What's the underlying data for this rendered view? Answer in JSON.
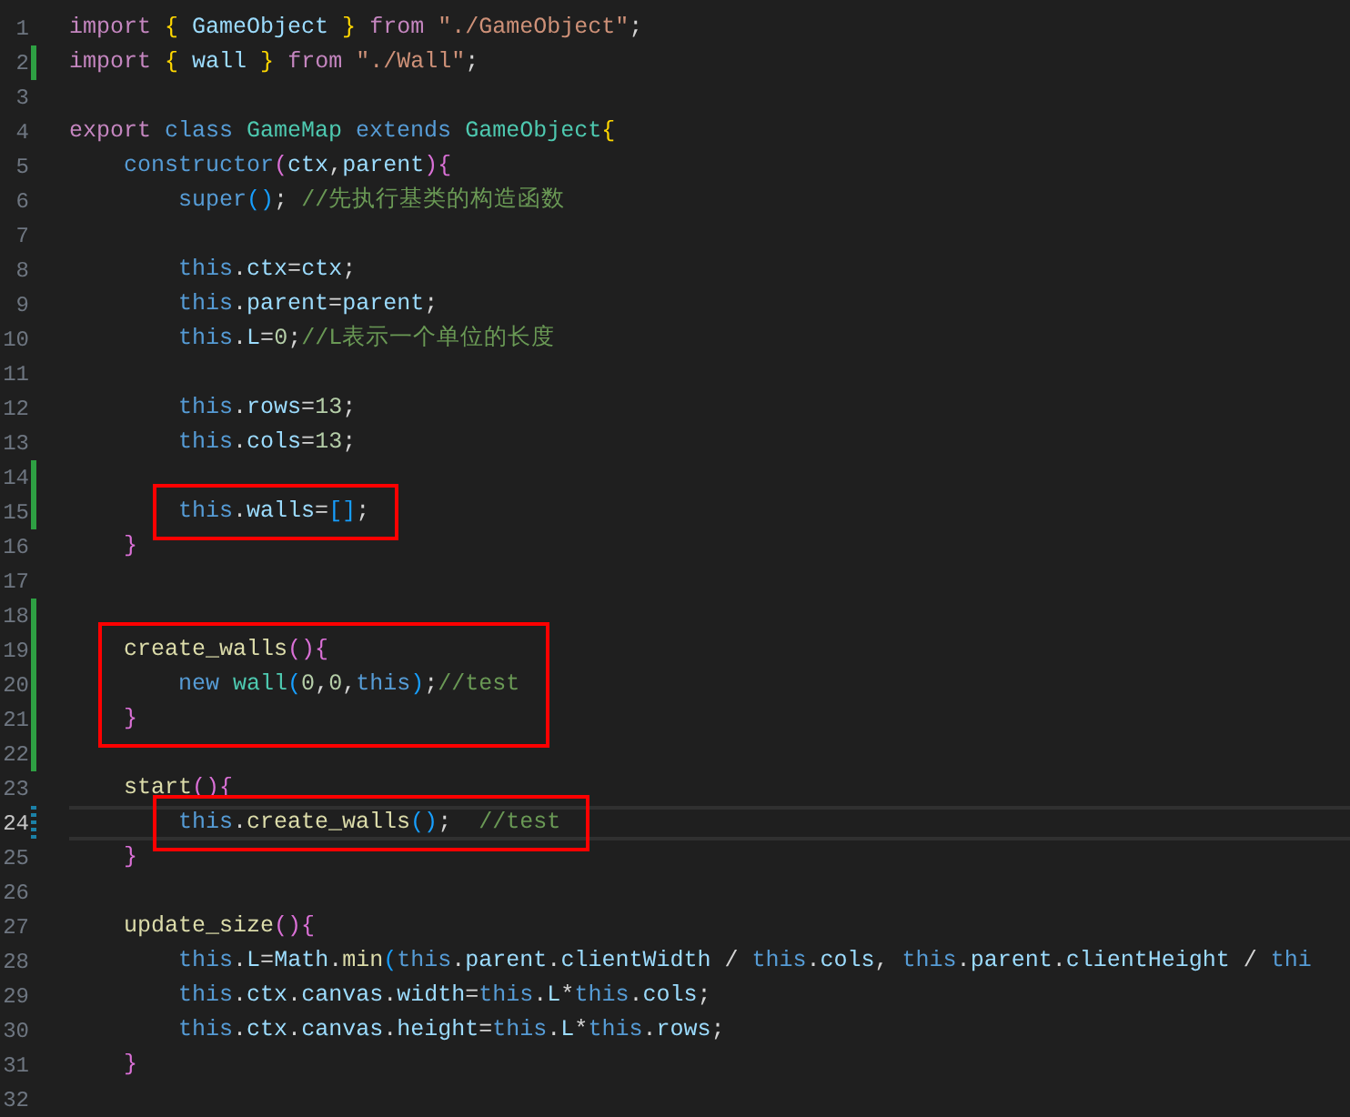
{
  "blocks": [
    {
      "boxed": false,
      "lines": [
        {
          "number": "1",
          "added": false,
          "modified": false,
          "current": false,
          "tokens": [
            {
              "text": "import ",
              "color": "#c586c0"
            },
            {
              "text": "{ ",
              "color": "#ffd700"
            },
            {
              "text": "GameObject ",
              "color": "#9cdcfe"
            },
            {
              "text": "} ",
              "color": "#ffd700"
            },
            {
              "text": "from ",
              "color": "#c586c0"
            },
            {
              "text": "\"./GameObject\"",
              "color": "#ce9178"
            },
            {
              "text": ";",
              "color": "#d4d4d4"
            }
          ]
        },
        {
          "number": "2",
          "added": true,
          "modified": false,
          "current": false,
          "tokens": [
            {
              "text": "import ",
              "color": "#c586c0"
            },
            {
              "text": "{ ",
              "color": "#ffd700"
            },
            {
              "text": "wall ",
              "color": "#9cdcfe"
            },
            {
              "text": "} ",
              "color": "#ffd700"
            },
            {
              "text": "from ",
              "color": "#c586c0"
            },
            {
              "text": "\"./Wall\"",
              "color": "#ce9178"
            },
            {
              "text": ";",
              "color": "#d4d4d4"
            }
          ]
        },
        {
          "number": "3",
          "added": false,
          "modified": false,
          "current": false
        },
        {
          "number": "4",
          "added": false,
          "modified": false,
          "current": false,
          "tokens": [
            {
              "text": "export ",
              "color": "#c586c0"
            },
            {
              "text": "class ",
              "color": "#569cd6"
            },
            {
              "text": "GameMap ",
              "color": "#4ec9b0"
            },
            {
              "text": "extends ",
              "color": "#569cd6"
            },
            {
              "text": "GameObject",
              "color": "#4ec9b0"
            },
            {
              "text": "{",
              "color": "#ffd700"
            }
          ]
        },
        {
          "number": "5",
          "added": false,
          "modified": false,
          "current": false,
          "tokens": [
            {
              "text": "    constructor",
              "color": "#569cd6"
            },
            {
              "text": "(",
              "color": "#da70d6"
            },
            {
              "text": "ctx",
              "color": "#9cdcfe"
            },
            {
              "text": ",",
              "color": "#d4d4d4"
            },
            {
              "text": "parent",
              "color": "#9cdcfe"
            },
            {
              "text": "){",
              "color": "#da70d6"
            }
          ]
        },
        {
          "number": "6",
          "added": false,
          "modified": false,
          "current": false,
          "tokens": [
            {
              "text": "        super",
              "color": "#569cd6"
            },
            {
              "text": "()",
              "color": "#179fff"
            },
            {
              "text": "; ",
              "color": "#d4d4d4"
            },
            {
              "text": "//先执行基类的构造函数",
              "color": "#6a9955"
            }
          ]
        },
        {
          "number": "7",
          "added": false,
          "modified": false,
          "current": false
        },
        {
          "number": "8",
          "added": false,
          "modified": false,
          "current": false,
          "tokens": [
            {
              "text": "        this",
              "color": "#569cd6"
            },
            {
              "text": ".",
              "color": "#d4d4d4"
            },
            {
              "text": "ctx",
              "color": "#9cdcfe"
            },
            {
              "text": "=",
              "color": "#d4d4d4"
            },
            {
              "text": "ctx",
              "color": "#9cdcfe"
            },
            {
              "text": ";",
              "color": "#d4d4d4"
            }
          ]
        },
        {
          "number": "9",
          "added": false,
          "modified": false,
          "current": false,
          "tokens": [
            {
              "text": "        this",
              "color": "#569cd6"
            },
            {
              "text": ".",
              "color": "#d4d4d4"
            },
            {
              "text": "parent",
              "color": "#9cdcfe"
            },
            {
              "text": "=",
              "color": "#d4d4d4"
            },
            {
              "text": "parent",
              "color": "#9cdcfe"
            },
            {
              "text": ";",
              "color": "#d4d4d4"
            }
          ]
        },
        {
          "number": "10",
          "added": false,
          "modified": false,
          "current": false,
          "tokens": [
            {
              "text": "        this",
              "color": "#569cd6"
            },
            {
              "text": ".",
              "color": "#d4d4d4"
            },
            {
              "text": "L",
              "color": "#9cdcfe"
            },
            {
              "text": "=",
              "color": "#d4d4d4"
            },
            {
              "text": "0",
              "color": "#b5cea8"
            },
            {
              "text": ";",
              "color": "#d4d4d4"
            },
            {
              "text": "//L表示一个单位的长度",
              "color": "#6a9955"
            }
          ]
        },
        {
          "number": "11",
          "added": false,
          "modified": false,
          "current": false
        },
        {
          "number": "12",
          "added": false,
          "modified": false,
          "current": false,
          "tokens": [
            {
              "text": "        this",
              "color": "#569cd6"
            },
            {
              "text": ".",
              "color": "#d4d4d4"
            },
            {
              "text": "rows",
              "color": "#9cdcfe"
            },
            {
              "text": "=",
              "color": "#d4d4d4"
            },
            {
              "text": "13",
              "color": "#b5cea8"
            },
            {
              "text": ";",
              "color": "#d4d4d4"
            }
          ]
        },
        {
          "number": "13",
          "added": false,
          "modified": false,
          "current": false,
          "tokens": [
            {
              "text": "        this",
              "color": "#569cd6"
            },
            {
              "text": ".",
              "color": "#d4d4d4"
            },
            {
              "text": "cols",
              "color": "#9cdcfe"
            },
            {
              "text": "=",
              "color": "#d4d4d4"
            },
            {
              "text": "13",
              "color": "#b5cea8"
            },
            {
              "text": ";",
              "color": "#d4d4d4"
            }
          ]
        },
        {
          "number": "14",
          "added": true,
          "modified": false,
          "current": false
        }
      ]
    },
    {
      "boxed": true,
      "lines": [
        {
          "number": "15",
          "added": true,
          "modified": false,
          "current": false,
          "tokens": [
            {
              "text": "        this",
              "color": "#569cd6"
            },
            {
              "text": ".",
              "color": "#d4d4d4"
            },
            {
              "text": "walls",
              "color": "#9cdcfe"
            },
            {
              "text": "=",
              "color": "#d4d4d4"
            },
            {
              "text": "[]",
              "color": "#179fff"
            },
            {
              "text": ";",
              "color": "#d4d4d4"
            }
          ]
        }
      ]
    },
    {
      "boxed": false,
      "lines": [
        {
          "number": "16",
          "added": false,
          "modified": false,
          "current": false,
          "tokens": [
            {
              "text": "    }",
              "color": "#da70d6"
            }
          ]
        },
        {
          "number": "17",
          "added": false,
          "modified": false,
          "current": false
        },
        {
          "number": "18",
          "added": true,
          "modified": false,
          "current": false
        }
      ]
    },
    {
      "boxed": true,
      "lines": [
        {
          "number": "19",
          "added": true,
          "modified": false,
          "current": false,
          "tokens": [
            {
              "text": "    create_walls",
              "color": "#dcdcaa"
            },
            {
              "text": "(){",
              "color": "#da70d6"
            }
          ]
        },
        {
          "number": "20",
          "added": true,
          "modified": false,
          "current": false,
          "tokens": [
            {
              "text": "        new ",
              "color": "#569cd6"
            },
            {
              "text": "wall",
              "color": "#4ec9b0"
            },
            {
              "text": "(",
              "color": "#179fff"
            },
            {
              "text": "0",
              "color": "#b5cea8"
            },
            {
              "text": ",",
              "color": "#d4d4d4"
            },
            {
              "text": "0",
              "color": "#b5cea8"
            },
            {
              "text": ",",
              "color": "#d4d4d4"
            },
            {
              "text": "this",
              "color": "#569cd6"
            },
            {
              "text": ")",
              "color": "#179fff"
            },
            {
              "text": ";",
              "color": "#d4d4d4"
            },
            {
              "text": "//test",
              "color": "#6a9955"
            }
          ]
        },
        {
          "number": "21",
          "added": true,
          "modified": false,
          "current": false,
          "tokens": [
            {
              "text": "    }",
              "color": "#da70d6"
            }
          ]
        }
      ]
    },
    {
      "boxed": false,
      "lines": [
        {
          "number": "22",
          "added": true,
          "modified": false,
          "current": false
        },
        {
          "number": "23",
          "added": false,
          "modified": false,
          "current": false,
          "tokens": [
            {
              "text": "    start",
              "color": "#dcdcaa"
            },
            {
              "text": "(){",
              "color": "#da70d6"
            }
          ]
        }
      ]
    },
    {
      "boxed": true,
      "lines": [
        {
          "number": "24",
          "modified": true,
          "current": true,
          "tokens": [
            {
              "text": "        this",
              "color": "#569cd6"
            },
            {
              "text": ".",
              "color": "#d4d4d4"
            },
            {
              "text": "create_walls",
              "color": "#dcdcaa"
            },
            {
              "text": "()",
              "color": "#179fff"
            },
            {
              "text": ";  ",
              "color": "#d4d4d4"
            },
            {
              "text": "//test",
              "color": "#6a9955"
            }
          ]
        }
      ]
    },
    {
      "boxed": false,
      "lines": [
        {
          "number": "25",
          "added": false,
          "modified": false,
          "current": false,
          "tokens": [
            {
              "text": "    }",
              "color": "#da70d6"
            }
          ]
        },
        {
          "number": "26",
          "added": false,
          "modified": false,
          "current": false
        },
        {
          "number": "27",
          "added": false,
          "modified": false,
          "current": false,
          "tokens": [
            {
              "text": "    update_size",
              "color": "#dcdcaa"
            },
            {
              "text": "(){",
              "color": "#da70d6"
            }
          ]
        },
        {
          "number": "28",
          "added": false,
          "modified": false,
          "current": false,
          "tokens": [
            {
              "text": "        this",
              "color": "#569cd6"
            },
            {
              "text": ".",
              "color": "#d4d4d4"
            },
            {
              "text": "L",
              "color": "#9cdcfe"
            },
            {
              "text": "=",
              "color": "#d4d4d4"
            },
            {
              "text": "Math",
              "color": "#9cdcfe"
            },
            {
              "text": ".",
              "color": "#d4d4d4"
            },
            {
              "text": "min",
              "color": "#dcdcaa"
            },
            {
              "text": "(",
              "color": "#179fff"
            },
            {
              "text": "this",
              "color": "#569cd6"
            },
            {
              "text": ".",
              "color": "#d4d4d4"
            },
            {
              "text": "parent",
              "color": "#9cdcfe"
            },
            {
              "text": ".",
              "color": "#d4d4d4"
            },
            {
              "text": "clientWidth",
              "color": "#9cdcfe"
            },
            {
              "text": " / ",
              "color": "#d4d4d4"
            },
            {
              "text": "this",
              "color": "#569cd6"
            },
            {
              "text": ".",
              "color": "#d4d4d4"
            },
            {
              "text": "cols",
              "color": "#9cdcfe"
            },
            {
              "text": ", ",
              "color": "#d4d4d4"
            },
            {
              "text": "this",
              "color": "#569cd6"
            },
            {
              "text": ".",
              "color": "#d4d4d4"
            },
            {
              "text": "parent",
              "color": "#9cdcfe"
            },
            {
              "text": ".",
              "color": "#d4d4d4"
            },
            {
              "text": "clientHeight",
              "color": "#9cdcfe"
            },
            {
              "text": " / ",
              "color": "#d4d4d4"
            },
            {
              "text": "thi",
              "color": "#569cd6"
            }
          ]
        },
        {
          "number": "29",
          "added": false,
          "modified": false,
          "current": false,
          "tokens": [
            {
              "text": "        this",
              "color": "#569cd6"
            },
            {
              "text": ".",
              "color": "#d4d4d4"
            },
            {
              "text": "ctx",
              "color": "#9cdcfe"
            },
            {
              "text": ".",
              "color": "#d4d4d4"
            },
            {
              "text": "canvas",
              "color": "#9cdcfe"
            },
            {
              "text": ".",
              "color": "#d4d4d4"
            },
            {
              "text": "width",
              "color": "#9cdcfe"
            },
            {
              "text": "=",
              "color": "#d4d4d4"
            },
            {
              "text": "this",
              "color": "#569cd6"
            },
            {
              "text": ".",
              "color": "#d4d4d4"
            },
            {
              "text": "L",
              "color": "#9cdcfe"
            },
            {
              "text": "*",
              "color": "#d4d4d4"
            },
            {
              "text": "this",
              "color": "#569cd6"
            },
            {
              "text": ".",
              "color": "#d4d4d4"
            },
            {
              "text": "cols",
              "color": "#9cdcfe"
            },
            {
              "text": ";",
              "color": "#d4d4d4"
            }
          ]
        },
        {
          "number": "30",
          "added": false,
          "modified": false,
          "current": false,
          "tokens": [
            {
              "text": "        this",
              "color": "#569cd6"
            },
            {
              "text": ".",
              "color": "#d4d4d4"
            },
            {
              "text": "ctx",
              "color": "#9cdcfe"
            },
            {
              "text": ".",
              "color": "#d4d4d4"
            },
            {
              "text": "canvas",
              "color": "#9cdcfe"
            },
            {
              "text": ".",
              "color": "#d4d4d4"
            },
            {
              "text": "height",
              "color": "#9cdcfe"
            },
            {
              "text": "=",
              "color": "#d4d4d4"
            },
            {
              "text": "this",
              "color": "#569cd6"
            },
            {
              "text": ".",
              "color": "#d4d4d4"
            },
            {
              "text": "L",
              "color": "#9cdcfe"
            },
            {
              "text": "*",
              "color": "#d4d4d4"
            },
            {
              "text": "this",
              "color": "#569cd6"
            },
            {
              "text": ".",
              "color": "#d4d4d4"
            },
            {
              "text": "rows",
              "color": "#9cdcfe"
            },
            {
              "text": ";",
              "color": "#d4d4d4"
            }
          ]
        },
        {
          "number": "31",
          "added": false,
          "modified": false,
          "current": false,
          "tokens": [
            {
              "text": "    }",
              "color": "#da70d6"
            }
          ]
        },
        {
          "number": "32",
          "added": false,
          "modified": false,
          "current": false
        }
      ]
    }
  ]
}
